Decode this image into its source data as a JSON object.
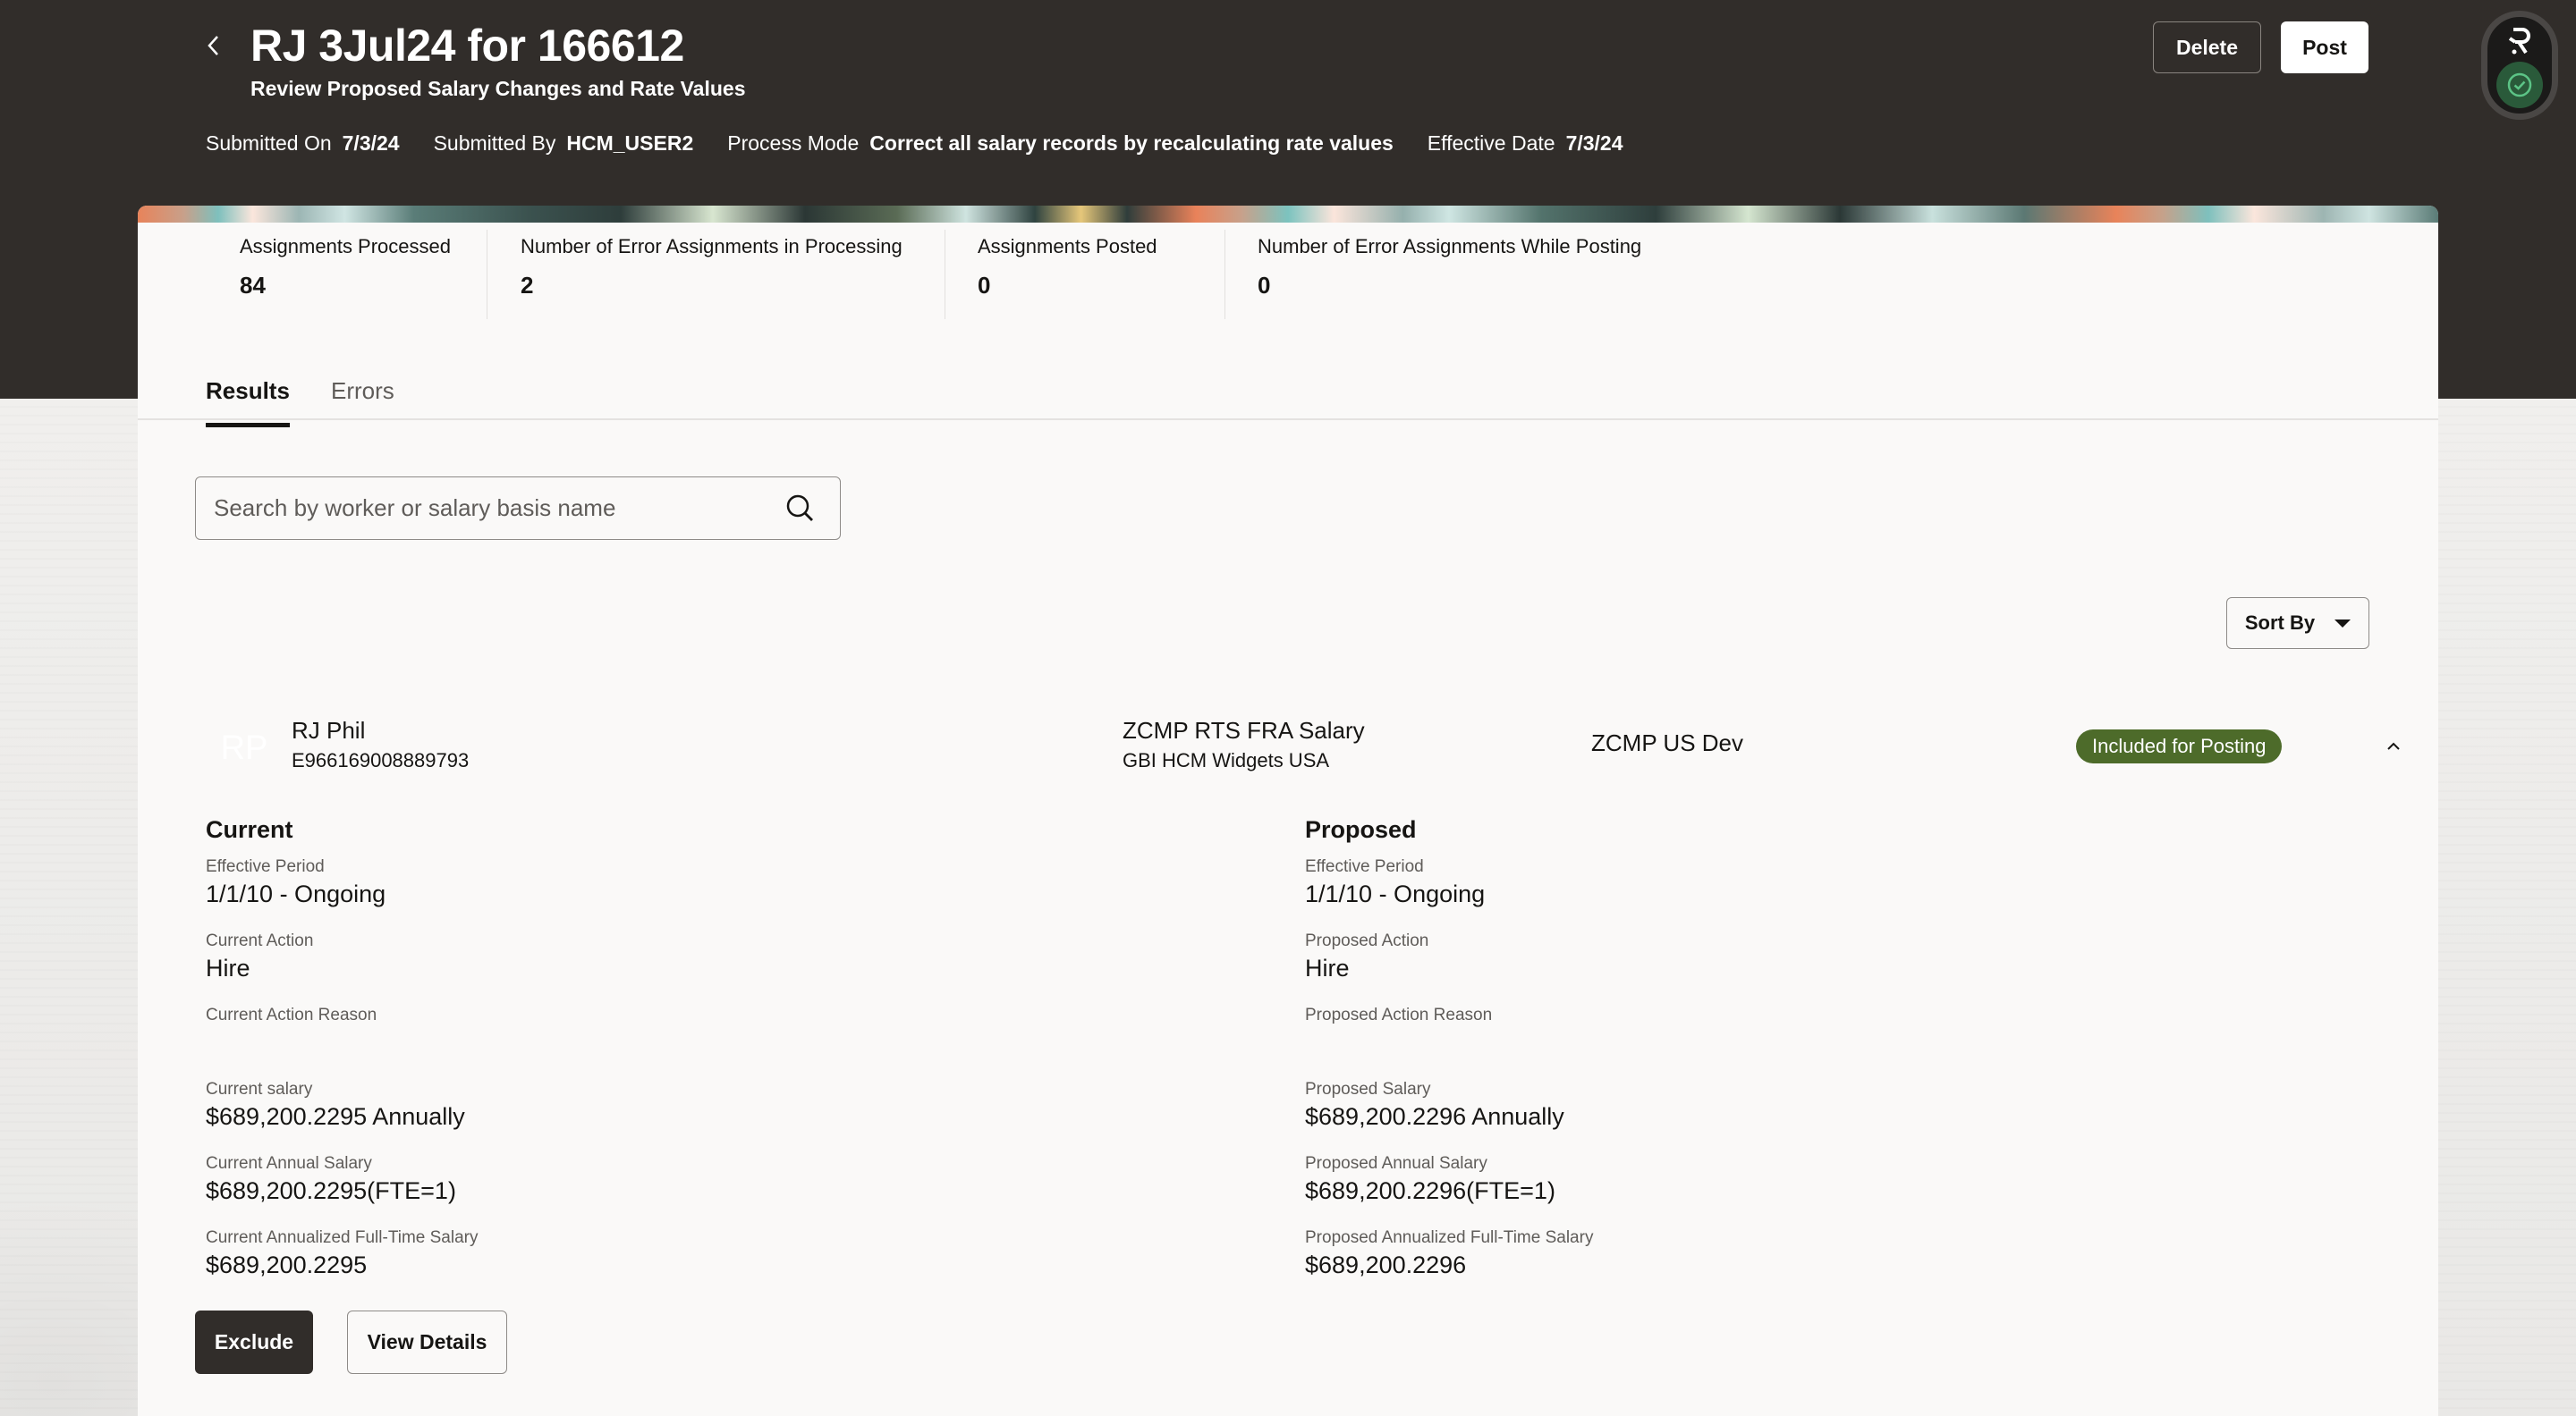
{
  "header": {
    "title": "RJ 3Jul24 for 166612",
    "subtitle": "Review Proposed Salary Changes and Rate Values",
    "back_icon": "chevron-left-icon",
    "meta": [
      {
        "label": "Submitted On",
        "value": "7/3/24"
      },
      {
        "label": "Submitted By",
        "value": "HCM_USER2"
      },
      {
        "label": "Process Mode",
        "value": "Correct all salary records by recalculating rate values"
      },
      {
        "label": "Effective Date",
        "value": "7/3/24"
      }
    ],
    "actions": {
      "delete_label": "Delete",
      "post_label": "Post"
    },
    "assistant": {
      "logo_icon": "assistant-logo-icon",
      "status_icon": "check-circle-icon",
      "status_color": "#2a5a3a"
    }
  },
  "stats": [
    {
      "label": "Assignments Processed",
      "value": "84"
    },
    {
      "label": "Number of Error Assignments in Processing",
      "value": "2"
    },
    {
      "label": "Assignments Posted",
      "value": "0"
    },
    {
      "label": "Number of Error Assignments While Posting",
      "value": "0"
    }
  ],
  "tabs": [
    {
      "label": "Results",
      "active": true
    },
    {
      "label": "Errors",
      "active": false
    }
  ],
  "search": {
    "placeholder": "Search by worker or salary basis name",
    "value": "",
    "icon": "search-icon"
  },
  "sort": {
    "label": "Sort By",
    "icon": "caret-down-icon"
  },
  "result": {
    "avatar_initials": "RP",
    "worker_name": "RJ Phil",
    "worker_id": "E966169008889793",
    "salary_basis": "ZCMP RTS FRA Salary",
    "legal_employer": "GBI HCM Widgets USA",
    "plan": "ZCMP US Dev",
    "status": "Included for Posting",
    "status_color": "#4d6b2a",
    "current": {
      "heading": "Current",
      "fields": [
        {
          "label": "Effective Period",
          "value": "1/1/10 - Ongoing"
        },
        {
          "label": "Current Action",
          "value": "Hire"
        },
        {
          "label": "Current Action Reason",
          "value": ""
        },
        {
          "label": "Current salary",
          "value": "$689,200.2295 Annually"
        },
        {
          "label": "Current Annual Salary",
          "value": "$689,200.2295(FTE=1)"
        },
        {
          "label": "Current Annualized Full-Time Salary",
          "value": "$689,200.2295"
        }
      ]
    },
    "proposed": {
      "heading": "Proposed",
      "fields": [
        {
          "label": "Effective Period",
          "value": "1/1/10 - Ongoing"
        },
        {
          "label": "Proposed Action",
          "value": "Hire"
        },
        {
          "label": "Proposed Action Reason",
          "value": ""
        },
        {
          "label": "Proposed Salary",
          "value": "$689,200.2296 Annually"
        },
        {
          "label": "Proposed Annual Salary",
          "value": "$689,200.2296(FTE=1)"
        },
        {
          "label": "Proposed Annualized Full-Time Salary",
          "value": "$689,200.2296"
        }
      ]
    },
    "actions": {
      "exclude_label": "Exclude",
      "details_label": "View Details"
    }
  }
}
